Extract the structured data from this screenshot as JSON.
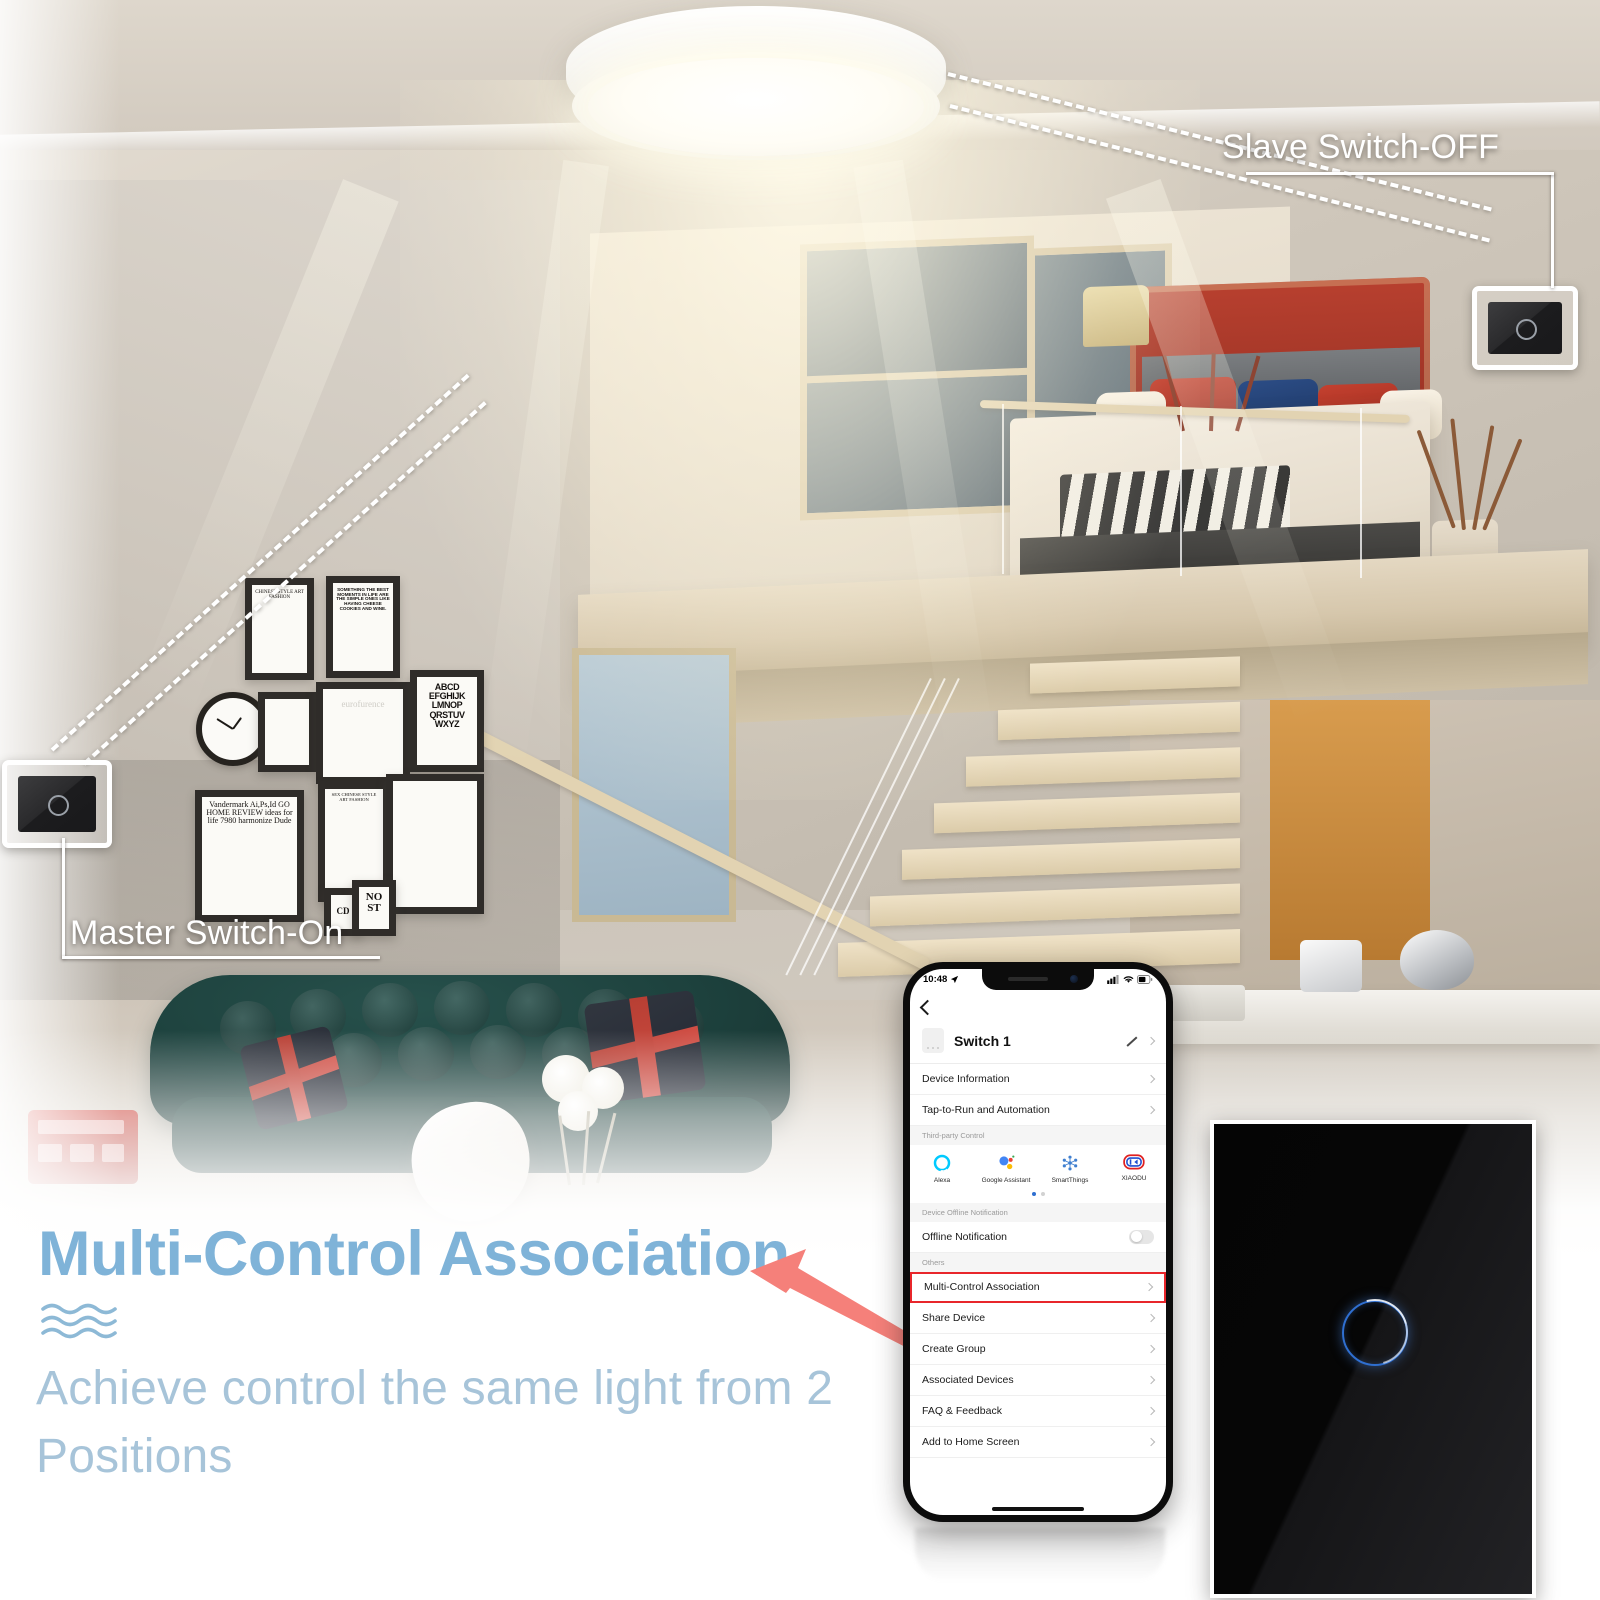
{
  "marketing": {
    "headline": "Multi-Control Association",
    "subtitle": "Achieve control the same light from 2 Positions",
    "wave_icon": "waves-icon",
    "arrow_icon": "left-arrow-icon",
    "headline_color": "#7fb3d8",
    "subtitle_color": "#a7c4d9",
    "arrow_color": "#f5807a"
  },
  "callouts": {
    "master": {
      "label": "Master Switch-On",
      "state": "On",
      "icon": "touch-switch-icon"
    },
    "slave": {
      "label": "Slave Switch-OFF",
      "state": "OFF",
      "icon": "touch-switch-icon"
    }
  },
  "scene": {
    "lamp": "ceiling-lamp-icon",
    "gallery_frames": [
      "CHINESE STYLE ART FASHION",
      "SOMETHING THE BEST MOMENTS IN LIFE ARE THE SIMPLE ONES LIKE HAVING CHEESE COOKIES AND WINE.",
      "eurofurence",
      "ABCD EFGHIJK LMNOP QRSTUV WXYZ",
      "Vandermark Ai,Ps,Id GO HOME REVIEW ideas for life 7980 harmonize Dude",
      "SEX CHINESE STYLE ART FASHION",
      "CD",
      "NO ST"
    ]
  },
  "panel": {
    "name": "wall-touch-switch-panel",
    "indicator": "touch-ring-indicator",
    "indicator_color": "#2f6fd0"
  },
  "phone": {
    "status": {
      "time": "10:48",
      "location_icon": "location-arrow-icon",
      "cellular_icon": "cellular-bars-icon",
      "wifi_icon": "wifi-icon",
      "battery_icon": "battery-icon"
    },
    "nav": {
      "back_icon": "back-chevron-icon"
    },
    "device": {
      "icon": "switch-device-icon",
      "name": "Switch 1",
      "edit_icon": "pencil-edit-icon",
      "chevron_icon": "chevron-right-icon"
    },
    "rows_top": [
      {
        "label": "Device Information",
        "chevron": "chevron-right-icon"
      },
      {
        "label": "Tap-to-Run and Automation",
        "chevron": "chevron-right-icon"
      }
    ],
    "third_party": {
      "section": "Third-party Control",
      "items": [
        {
          "label": "Alexa",
          "icon": "alexa-icon"
        },
        {
          "label": "Google Assistant",
          "icon": "google-assistant-icon"
        },
        {
          "label": "SmartThings",
          "icon": "smartthings-icon"
        },
        {
          "label": "XIAODU",
          "icon": "xiaodu-icon"
        }
      ],
      "page_dots": 2,
      "active_dot": 0
    },
    "offline": {
      "section": "Device Offline Notification",
      "label": "Offline Notification",
      "toggle_state": "off"
    },
    "others": {
      "section": "Others",
      "items": [
        {
          "label": "Multi-Control Association",
          "highlighted": true,
          "chevron": "chevron-right-icon"
        },
        {
          "label": "Share Device",
          "highlighted": false,
          "chevron": "chevron-right-icon"
        },
        {
          "label": "Create Group",
          "highlighted": false,
          "chevron": "chevron-right-icon"
        },
        {
          "label": "Associated Devices",
          "highlighted": false,
          "chevron": "chevron-right-icon"
        },
        {
          "label": "FAQ & Feedback",
          "highlighted": false,
          "chevron": "chevron-right-icon"
        },
        {
          "label": "Add to Home Screen",
          "highlighted": false,
          "chevron": "chevron-right-icon"
        }
      ],
      "highlight_color": "#e8262b"
    }
  }
}
